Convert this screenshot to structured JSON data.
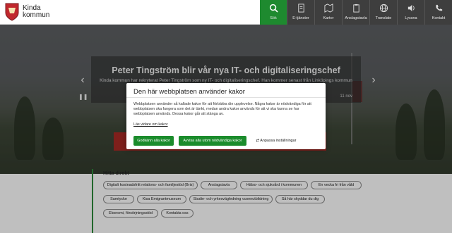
{
  "header": {
    "logo_line1": "Kinda",
    "logo_line2": "kommun",
    "nav": [
      {
        "label": "Sök",
        "icon": "search-icon",
        "active": true
      },
      {
        "label": "E-tjänster",
        "icon": "document-icon"
      },
      {
        "label": "Kartor",
        "icon": "map-icon"
      },
      {
        "label": "Anslagstavla",
        "icon": "clipboard-icon"
      },
      {
        "label": "Translate",
        "icon": "globe-icon"
      },
      {
        "label": "Lyssna",
        "icon": "speaker-icon"
      },
      {
        "label": "Kontakt",
        "icon": "phone-icon"
      }
    ]
  },
  "hero": {
    "title": "Peter Tingström blir vår nya IT- och digitaliseringschef",
    "text": "Kinda kommun har rekryterat Peter Tingström som ny IT- och digitaliseringschef. Han kommer senast från Linköpings kommun och rollen ... sektor",
    "date": "11 nov"
  },
  "quick_links": {
    "title": "Hitta direkt",
    "chips": [
      "Digitalt kostnadsfritt relations- och familjestöd (Bris)",
      "Anslagstavla",
      "Hälso- och sjukvård i kommunen",
      "En vecka fri från våld",
      "Samtycke",
      "Kisa Emigrantmuseum",
      "Studie- och yrkesvägledning vuxenutbildning",
      "Så här skyddar du dig",
      "Ekonomi, försörjningsstöd",
      "Kontakta oss"
    ]
  },
  "cookie_dialog": {
    "title": "Den här webbplatsen använder kakor",
    "body": "Webbplatsen använder så kallade kakor för att förbättra din upplevelse. Några kakor är nödvändiga för att webbplatsen ska fungera som det är tänkt, medan andra kakor används för att vi ska kunna se hur webbplatsen används. Dessa kakor går att stänga av.",
    "link": "Läs vidare om kakor",
    "accept_all": "Godkänn alla kakor",
    "reject_all": "Avvisa alla utom nödvändiga kakor",
    "customize": "Anpassa inställningar"
  }
}
